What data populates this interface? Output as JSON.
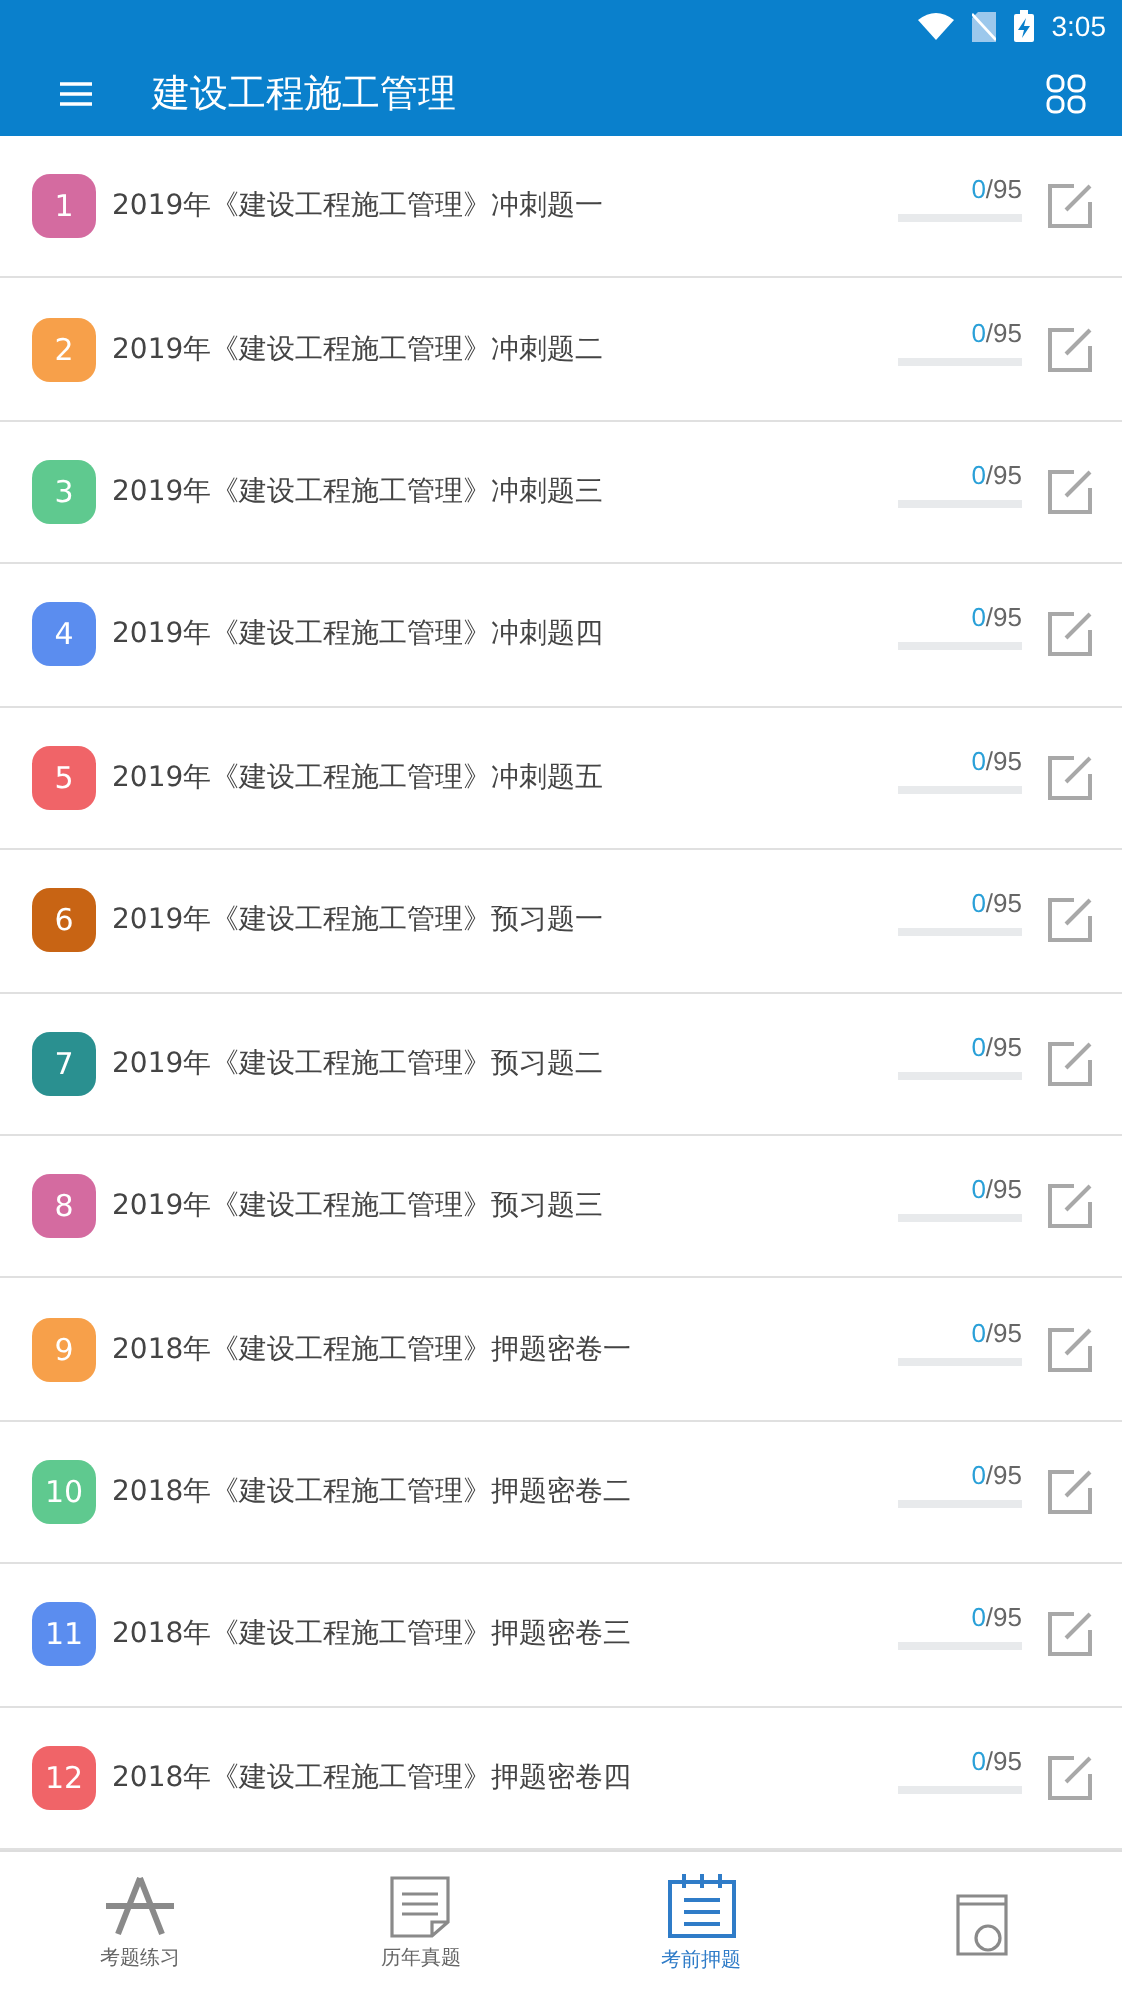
{
  "status_bar": {
    "time": "3:05"
  },
  "app_bar": {
    "title": "建设工程施工管理"
  },
  "papers": [
    {
      "number": "1",
      "color": "#d46ba0",
      "title": "2019年《建设工程施工管理》冲刺题一",
      "done": "0",
      "total": "/95",
      "level": 0
    },
    {
      "number": "2",
      "color": "#f7a04a",
      "title": "2019年《建设工程施工管理》冲刺题二",
      "done": "0",
      "total": "/95",
      "level": 0
    },
    {
      "number": "3",
      "color": "#5fc98f",
      "title": "2019年《建设工程施工管理》冲刺题三",
      "done": "0",
      "total": "/95",
      "level": 0
    },
    {
      "number": "4",
      "color": "#5b8def",
      "title": "2019年《建设工程施工管理》冲刺题四",
      "done": "0",
      "total": "/95",
      "level": 0
    },
    {
      "number": "5",
      "color": "#f06468",
      "title": "2019年《建设工程施工管理》冲刺题五",
      "done": "0",
      "total": "/95",
      "level": 0
    },
    {
      "number": "6",
      "color": "#c86414",
      "title": "2019年《建设工程施工管理》预习题一",
      "done": "0",
      "total": "/95",
      "level": 0
    },
    {
      "number": "7",
      "color": "#2a9090",
      "title": "2019年《建设工程施工管理》预习题二",
      "done": "0",
      "total": "/95",
      "level": 0
    },
    {
      "number": "8",
      "color": "#d46ba0",
      "title": "2019年《建设工程施工管理》预习题三",
      "done": "0",
      "total": "/95",
      "level": 0
    },
    {
      "number": "9",
      "color": "#f7a04a",
      "title": "2018年《建设工程施工管理》押题密卷一",
      "done": "0",
      "total": "/95",
      "level": 0
    },
    {
      "number": "10",
      "color": "#5fc98f",
      "title": "2018年《建设工程施工管理》押题密卷二",
      "done": "0",
      "total": "/95",
      "level": 0
    },
    {
      "number": "11",
      "color": "#5b8def",
      "title": "2018年《建设工程施工管理》押题密卷三",
      "done": "0",
      "total": "/95",
      "level": 0
    },
    {
      "number": "12",
      "color": "#f06468",
      "title": "2018年《建设工程施工管理》押题密卷四",
      "done": "0",
      "total": "/95",
      "level": 0
    }
  ],
  "bottom_nav": [
    {
      "kind": "compass",
      "label": "考题练习",
      "selected": false
    },
    {
      "kind": "document",
      "label": "历年真题",
      "selected": false
    },
    {
      "kind": "calendar",
      "label": "考前押题",
      "selected": true
    },
    {
      "kind": "book",
      "selected": false
    }
  ]
}
